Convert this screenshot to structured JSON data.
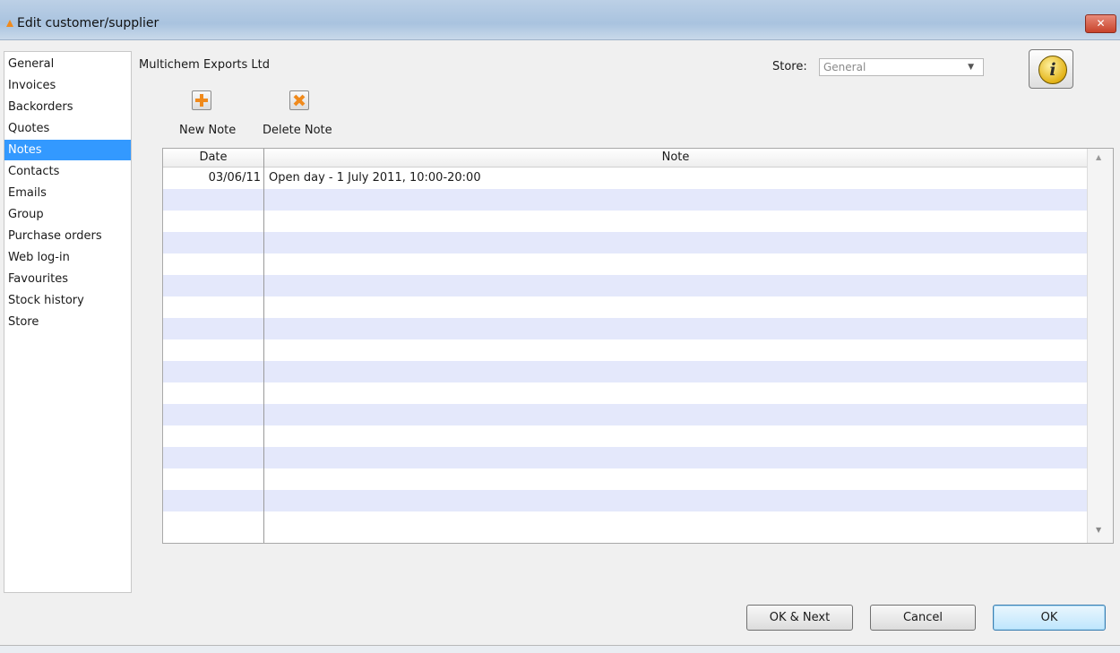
{
  "window": {
    "title": "Edit customer/supplier",
    "close_label": "✕"
  },
  "sidebar": {
    "items": [
      {
        "label": "General"
      },
      {
        "label": "Invoices"
      },
      {
        "label": "Backorders"
      },
      {
        "label": "Quotes"
      },
      {
        "label": "Notes",
        "selected": true
      },
      {
        "label": "Contacts"
      },
      {
        "label": "Emails"
      },
      {
        "label": "Group"
      },
      {
        "label": "Purchase orders"
      },
      {
        "label": "Web log-in"
      },
      {
        "label": "Favourites"
      },
      {
        "label": "Stock history"
      },
      {
        "label": "Store"
      }
    ]
  },
  "header": {
    "customer_name": "Multichem Exports Ltd",
    "store_label": "Store:",
    "store_value": "General"
  },
  "toolbar": {
    "new_note_label": "New Note",
    "new_note_icon": "add-note-icon",
    "delete_note_label": "Delete Note",
    "delete_note_icon": "delete-note-icon",
    "info_glyph": "i"
  },
  "notes_table": {
    "columns": [
      "Date",
      "Note"
    ],
    "rows": [
      {
        "date": "03/06/11",
        "note": "Open day - 1 July 2011, 10:00-20:00"
      }
    ],
    "stripe_color": "#e4e8fb"
  },
  "footer": {
    "ok_next_label": "OK & Next",
    "cancel_label": "Cancel",
    "ok_label": "OK"
  },
  "colors": {
    "selection": "#3399ff",
    "icon_orange": "#f08a1c"
  }
}
